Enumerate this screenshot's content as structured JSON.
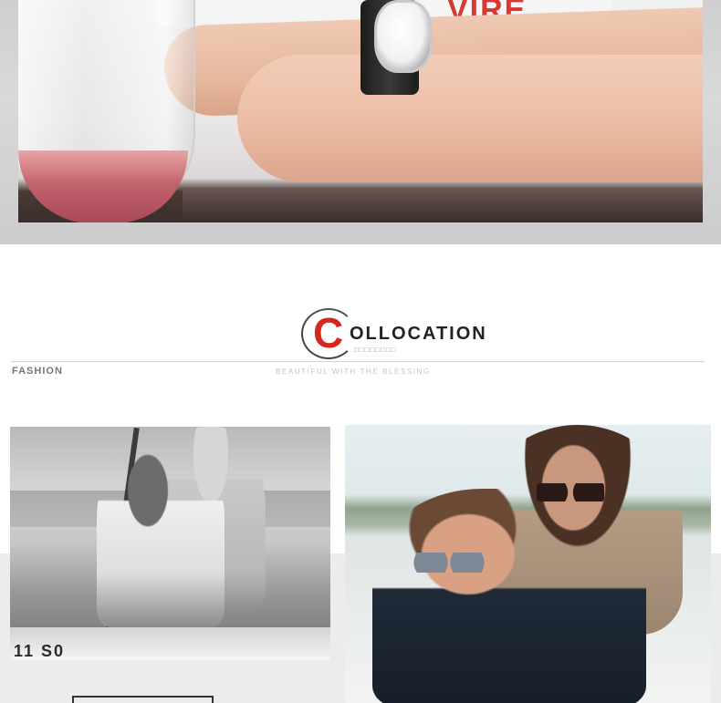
{
  "hero": {
    "shirt_print": "VIRE",
    "subject": "wrist-watch-wine-glass"
  },
  "section": {
    "logo_initial": "C",
    "logo_rest": "OLLOCATION",
    "logo_subtitle": "□□□□□□□□",
    "left_label": "FASHION",
    "tagline": "BEAUTIFUL WITH THE BLESSING"
  },
  "gallery": {
    "left_photo": {
      "boat_text": "11 S0"
    }
  },
  "colors": {
    "accent": "#d7261e",
    "text_dark": "#222222",
    "text_muted": "#777777",
    "rule": "#d4d4d4"
  }
}
